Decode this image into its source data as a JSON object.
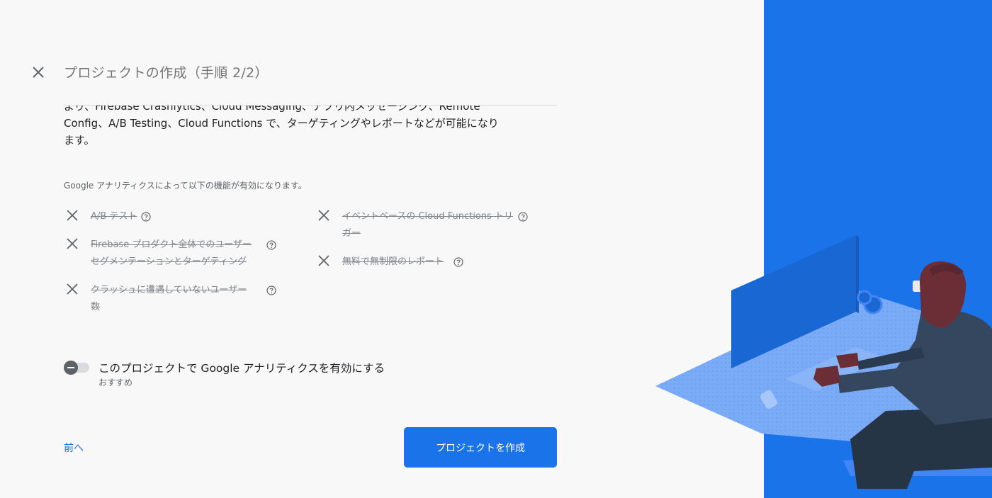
{
  "header": {
    "title": "プロジェクトの作成（手順 2/2）"
  },
  "description": {
    "line1": "より、Firebase Crashlytics、Cloud Messaging、アプリ内メッセージング、Remote",
    "line2": "Config、A/B Testing、Cloud Functions で、ターゲティングやレポートなどが可能になり",
    "line3": "ます。"
  },
  "features": {
    "intro": "Google アナリティクスによって以下の機能が有効になります。",
    "items": [
      {
        "line1": "A/B テスト",
        "line2": ""
      },
      {
        "line1": "イベントベースの Cloud Functions トリ",
        "line2": "ガー"
      },
      {
        "line1": "Firebase プロダクト全体でのユーザー",
        "line2": "セグメンテーションとターゲティング"
      },
      {
        "line1": "無料で無制限のレポート",
        "line2": ""
      },
      {
        "line1": "クラッシュに遭遇していないユーザー",
        "line2": "数"
      }
    ]
  },
  "analytics_toggle": {
    "label": "このプロジェクトで Google アナリティクスを有効にする",
    "sublabel": "おすすめ",
    "enabled": false
  },
  "actions": {
    "back_label": "前へ",
    "create_label": "プロジェクトを作成"
  },
  "colors": {
    "accent": "#1a73e8",
    "illustration_bg": "#1a73e8"
  },
  "icons": {
    "close": "close-icon",
    "feature_disabled": "x-icon",
    "help": "help-circle-icon"
  }
}
